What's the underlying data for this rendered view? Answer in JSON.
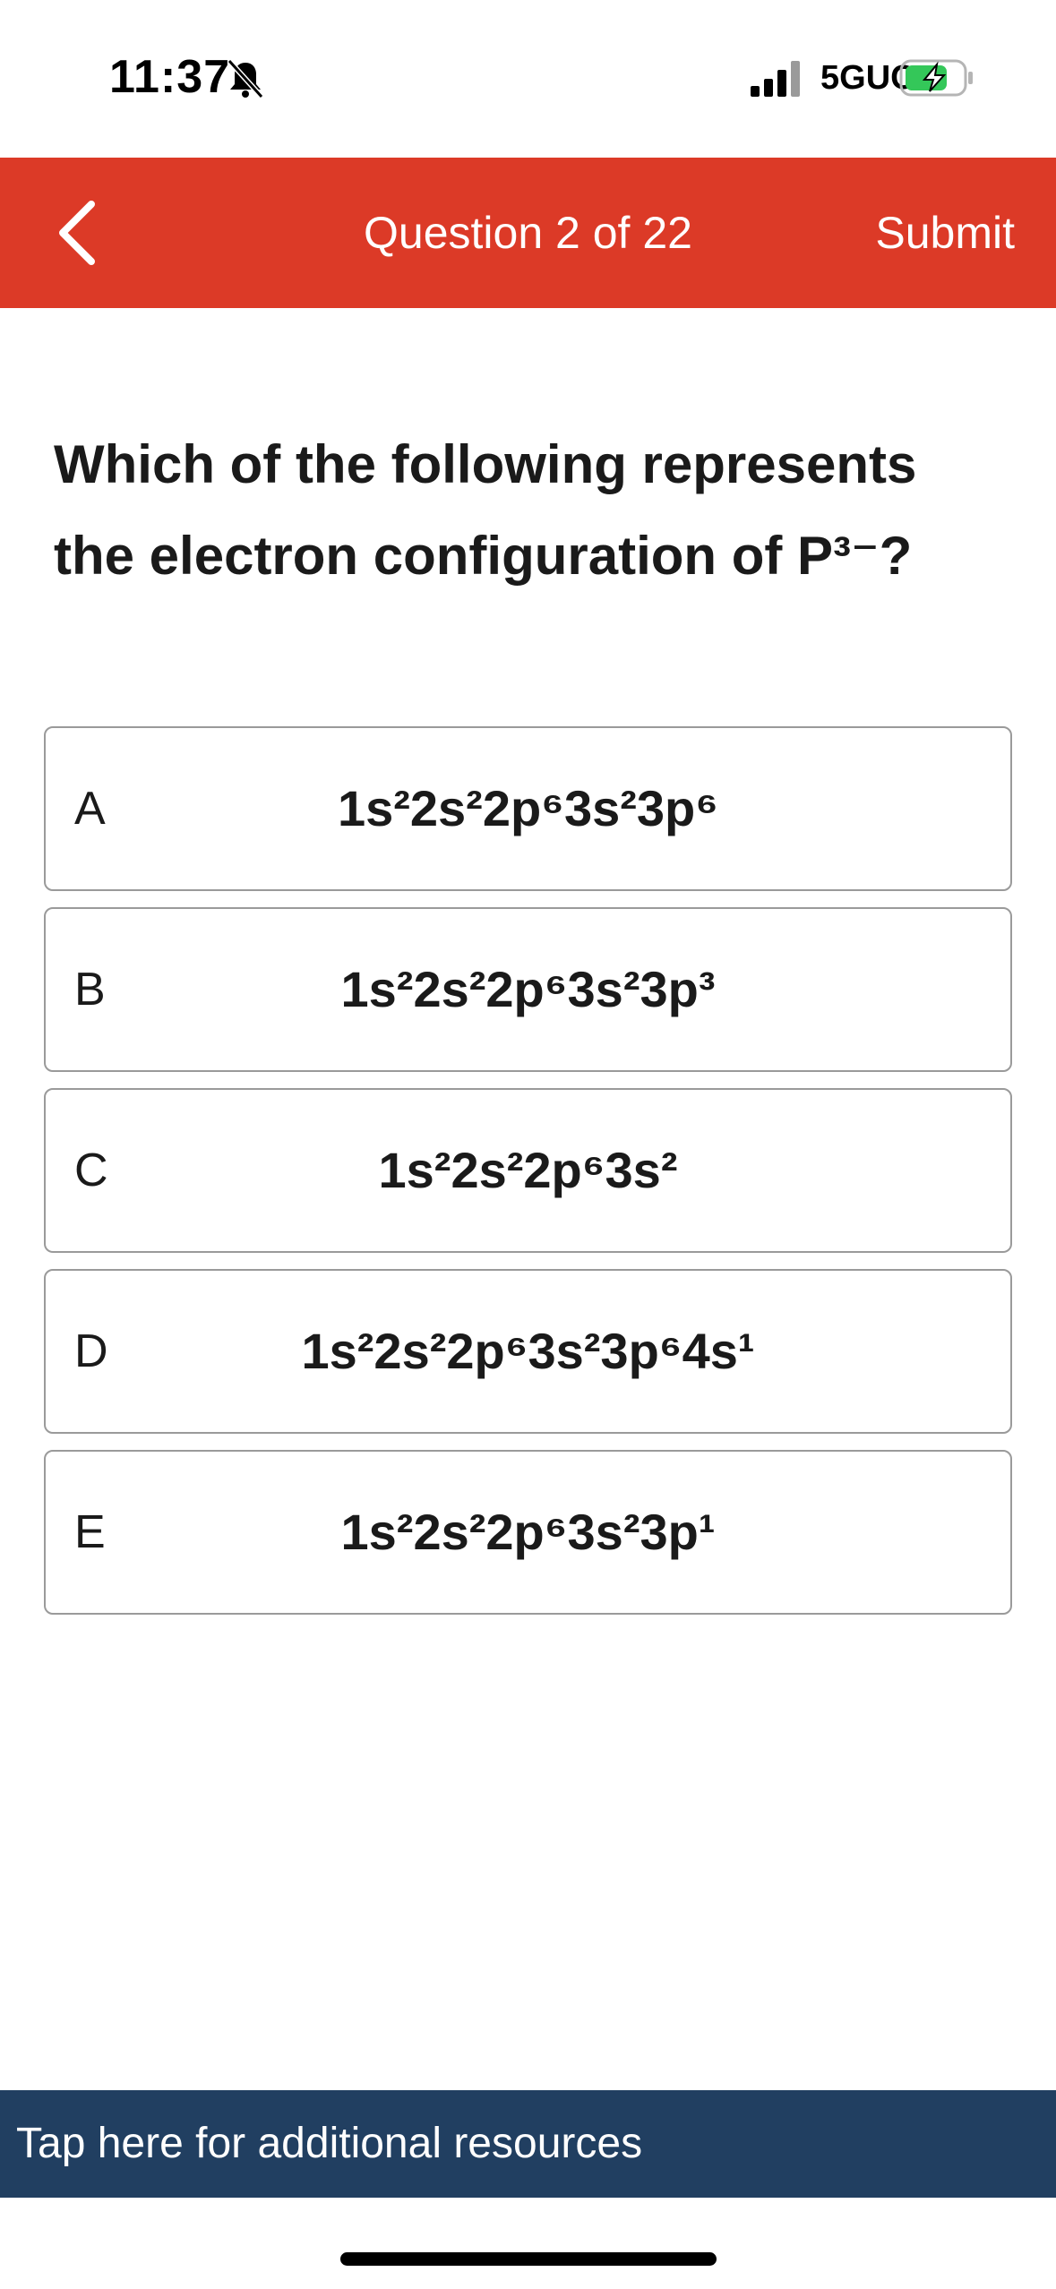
{
  "status_bar": {
    "time": "11:37",
    "network": "5GUC",
    "icons": [
      "bell-muted-icon",
      "signal-icon",
      "battery-charging-icon"
    ]
  },
  "header": {
    "title": "Question 2 of 22",
    "submit_label": "Submit",
    "back_icon": "chevron-left-icon",
    "background_color": "#dc3a27"
  },
  "question": {
    "text": "Which of the following represents the electron configuration of P³⁻?"
  },
  "options": [
    {
      "letter": "A",
      "text": "1s²2s²2p⁶3s²3p⁶"
    },
    {
      "letter": "B",
      "text": "1s²2s²2p⁶3s²3p³"
    },
    {
      "letter": "C",
      "text": "1s²2s²2p⁶3s²"
    },
    {
      "letter": "D",
      "text": "1s²2s²2p⁶3s²3p⁶4s¹"
    },
    {
      "letter": "E",
      "text": "1s²2s²2p⁶3s²3p¹"
    }
  ],
  "resources": {
    "label": "Tap here for additional resources",
    "background_color": "#213f61"
  }
}
